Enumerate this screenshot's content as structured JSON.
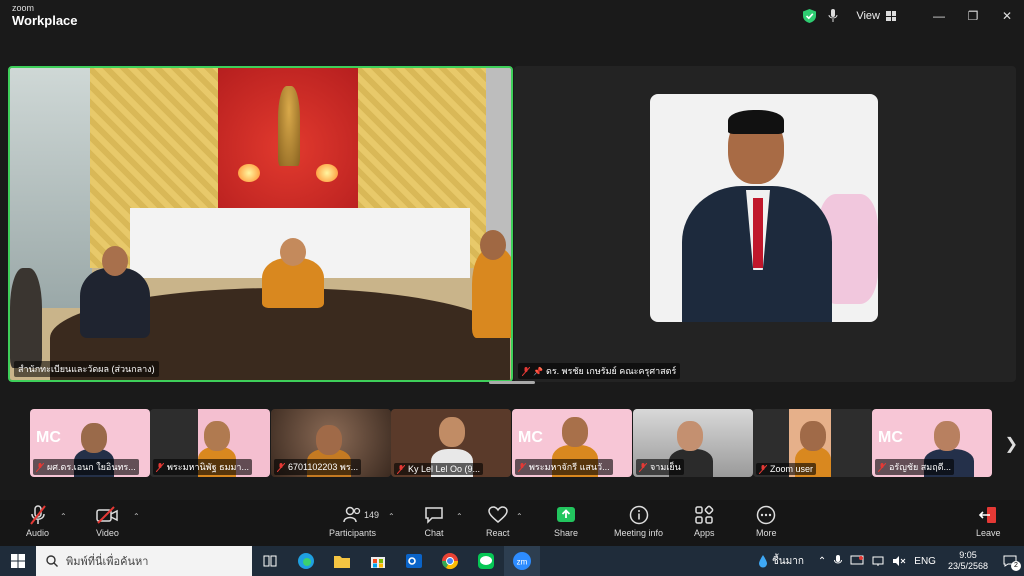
{
  "titlebar": {
    "brand_small": "zoom",
    "brand_large": "Workplace",
    "view_label": "View",
    "minimize": "—",
    "restore": "❐",
    "close": "✕"
  },
  "main_tiles": [
    {
      "name": "สำนักทะเบียนและวัดผล (ส่วนกลาง)"
    },
    {
      "name": "ดร. พรชัย เกษรัมย์ คณะครุศาสตร์"
    }
  ],
  "thumbnails": [
    {
      "name": "ผศ.ดร.เอนก ใยอินทร...",
      "bg": "#f7c6d6",
      "mc": "MC"
    },
    {
      "name": "พระมหานิพัฐ ธมมา...",
      "bg": "#f4bfd0",
      "mc": ""
    },
    {
      "name": "6701102203 พร...",
      "bg": "#8a6a55",
      "mc": ""
    },
    {
      "name": "Ky Lel Lel Oo (9...",
      "bg": "#5a3a2a",
      "mc": ""
    },
    {
      "name": "พระมหาจักรี แสนวั...",
      "bg": "#f7c6d6",
      "mc": "MC"
    },
    {
      "name": "จามเย็น",
      "bg": "#c8c8c8",
      "mc": ""
    },
    {
      "name": "Zoom user",
      "bg": "#3a3a3a",
      "mc": ""
    },
    {
      "name": "อรัญชัย สมฤดี...",
      "bg": "#f7c6d6",
      "mc": "MC"
    }
  ],
  "toolbar": {
    "audio": "Audio",
    "video": "Video",
    "participants": "Participants",
    "participant_count": "149",
    "chat": "Chat",
    "react": "React",
    "share": "Share",
    "meeting_info": "Meeting info",
    "apps": "Apps",
    "more": "More",
    "leave": "Leave"
  },
  "taskbar": {
    "search_placeholder": "พิมพ์ที่นี่เพื่อค้นหา",
    "weather": "ชื้นมาก",
    "lang": "ENG",
    "time": "9:05",
    "date": "23/5/2568",
    "notification_count": "2",
    "zoom_label": "zm"
  },
  "colors": {
    "active_border": "#3ecf5a",
    "share_green": "#22c55e",
    "mute_red": "#e53935"
  }
}
